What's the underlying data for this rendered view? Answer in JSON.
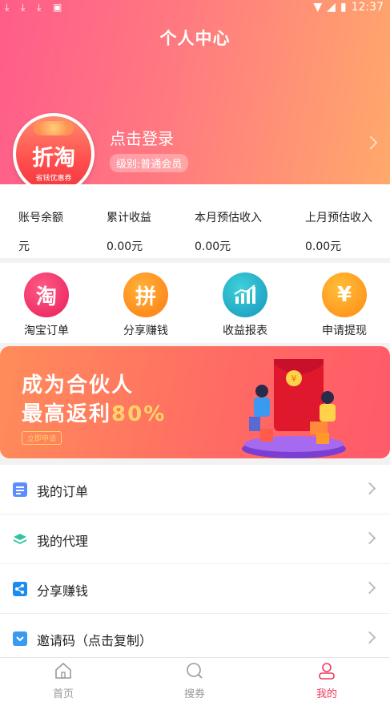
{
  "status_bar": {
    "time": "12:37"
  },
  "header": {
    "title": "个人中心",
    "login_text": "点击登录",
    "level": "级别:普通会员",
    "avatar_logo": "折淘",
    "avatar_sub": "省钱优惠券"
  },
  "stats": [
    {
      "label": "账号余额",
      "value": "元"
    },
    {
      "label": "累计收益",
      "value": "0.00元"
    },
    {
      "label": "本月预估收入",
      "value": "0.00元"
    },
    {
      "label": "上月预估收入",
      "value": "0.00元"
    }
  ],
  "actions": [
    {
      "label": "淘宝订单",
      "glyph": "淘",
      "color": "#f2336b",
      "icon": "taobao-icon"
    },
    {
      "label": "分享赚钱",
      "glyph": "拼",
      "color": "#ff8a1f",
      "icon": "pin-icon"
    },
    {
      "label": "收益报表",
      "glyph": "",
      "color": "#1fb0c8",
      "icon": "chart-icon"
    },
    {
      "label": "申请提现",
      "glyph": "¥",
      "color": "#ff9a1a",
      "icon": "moneybag-icon"
    }
  ],
  "banner": {
    "line1": "成为合伙人",
    "line2_prefix": "最高返利",
    "line2_pct": "80%",
    "button": "立即申请"
  },
  "menu": [
    {
      "label": "我的订单",
      "icon_color": "#5c8dff",
      "icon": "order-icon"
    },
    {
      "label": "我的代理",
      "icon_color": "#2fc4a0",
      "icon": "layers-icon"
    },
    {
      "label": "分享赚钱",
      "icon_color": "#1d8cf0",
      "icon": "share-icon"
    },
    {
      "label": "邀请码（点击复制）",
      "icon_color": "#3a9af0",
      "icon": "invite-icon"
    }
  ],
  "bottom_nav": [
    {
      "label": "首页",
      "icon": "home-icon"
    },
    {
      "label": "搜券",
      "icon": "search-icon"
    },
    {
      "label": "我的",
      "icon": "user-icon",
      "active": true
    }
  ]
}
